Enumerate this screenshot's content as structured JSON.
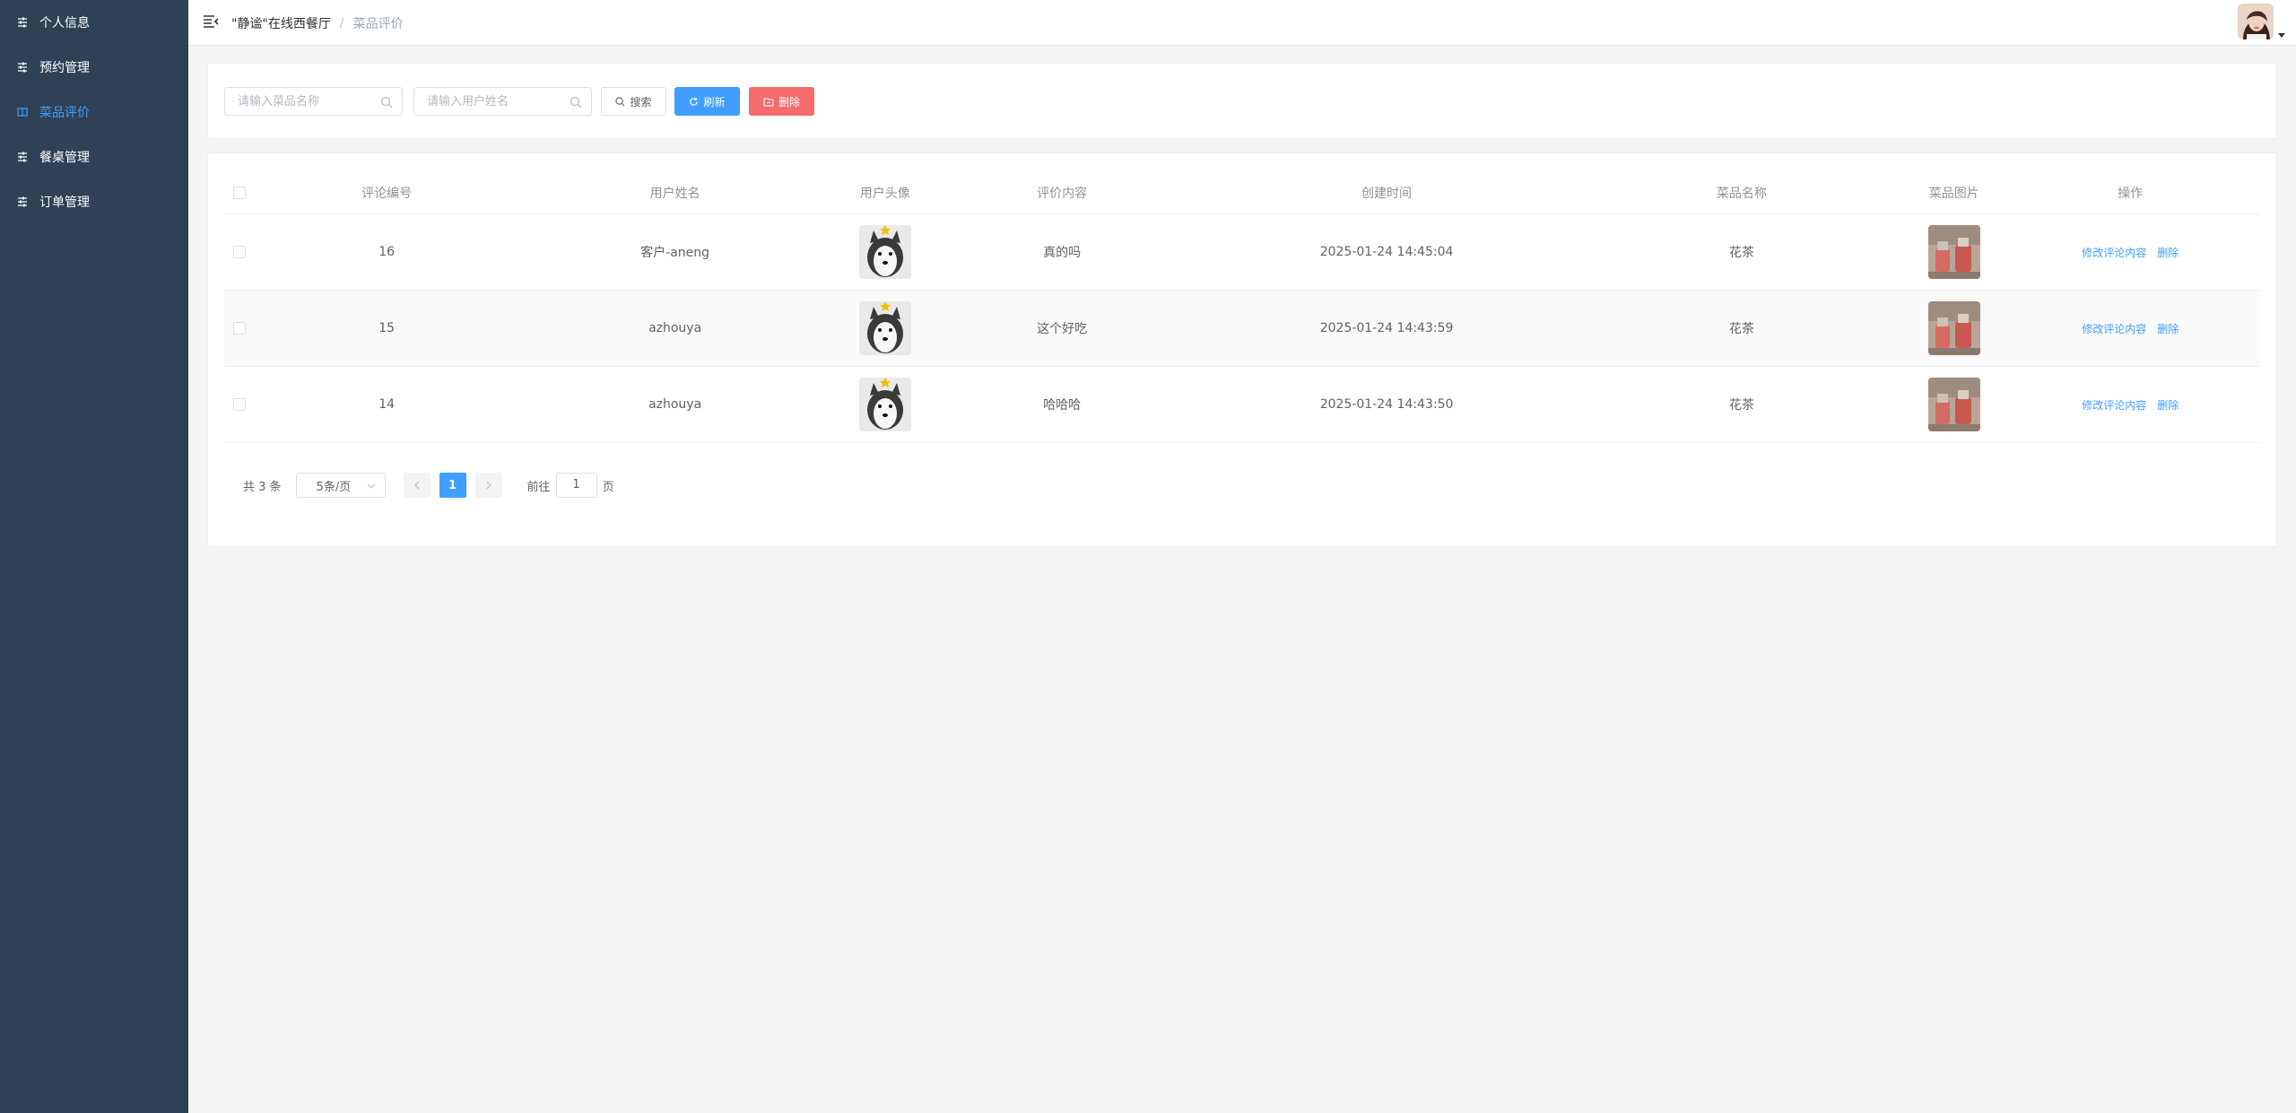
{
  "sidebar": {
    "items": [
      {
        "label": "个人信息",
        "icon": "sliders-icon",
        "active": false
      },
      {
        "label": "预约管理",
        "icon": "sliders-icon",
        "active": false
      },
      {
        "label": "菜品评价",
        "icon": "book-icon",
        "active": true
      },
      {
        "label": "餐桌管理",
        "icon": "sliders-icon",
        "active": false
      },
      {
        "label": "订单管理",
        "icon": "sliders-icon",
        "active": false
      }
    ]
  },
  "header": {
    "breadcrumb_home": "\"静谧\"在线西餐厅",
    "breadcrumb_separator": "/",
    "breadcrumb_current": "菜品评价"
  },
  "search": {
    "dish_placeholder": "请输入菜品名称",
    "user_placeholder": "请输入用户姓名",
    "search_label": "搜索",
    "refresh_label": "刷新",
    "delete_label": "删除"
  },
  "table": {
    "columns": [
      "评论编号",
      "用户姓名",
      "用户头像",
      "评价内容",
      "创建时间",
      "菜品名称",
      "菜品图片",
      "操作"
    ],
    "rows": [
      {
        "id": "16",
        "user": "客户-aneng",
        "content": "真的吗",
        "created": "2025-01-24 14:45:04",
        "dish": "花茶"
      },
      {
        "id": "15",
        "user": "azhouya",
        "content": "这个好吃",
        "created": "2025-01-24 14:43:59",
        "dish": "花茶"
      },
      {
        "id": "14",
        "user": "azhouya",
        "content": "哈哈哈",
        "created": "2025-01-24 14:43:50",
        "dish": "花茶"
      }
    ],
    "edit_label": "修改评论内容",
    "delete_label": "删除"
  },
  "pagination": {
    "total_text": "共 3 条",
    "page_size": "5条/页",
    "current_page": "1",
    "goto_prefix": "前往",
    "goto_value": "1",
    "goto_suffix": "页"
  },
  "colors": {
    "sidebar_bg": "#304156",
    "primary": "#409eff",
    "danger": "#f56c6c"
  }
}
